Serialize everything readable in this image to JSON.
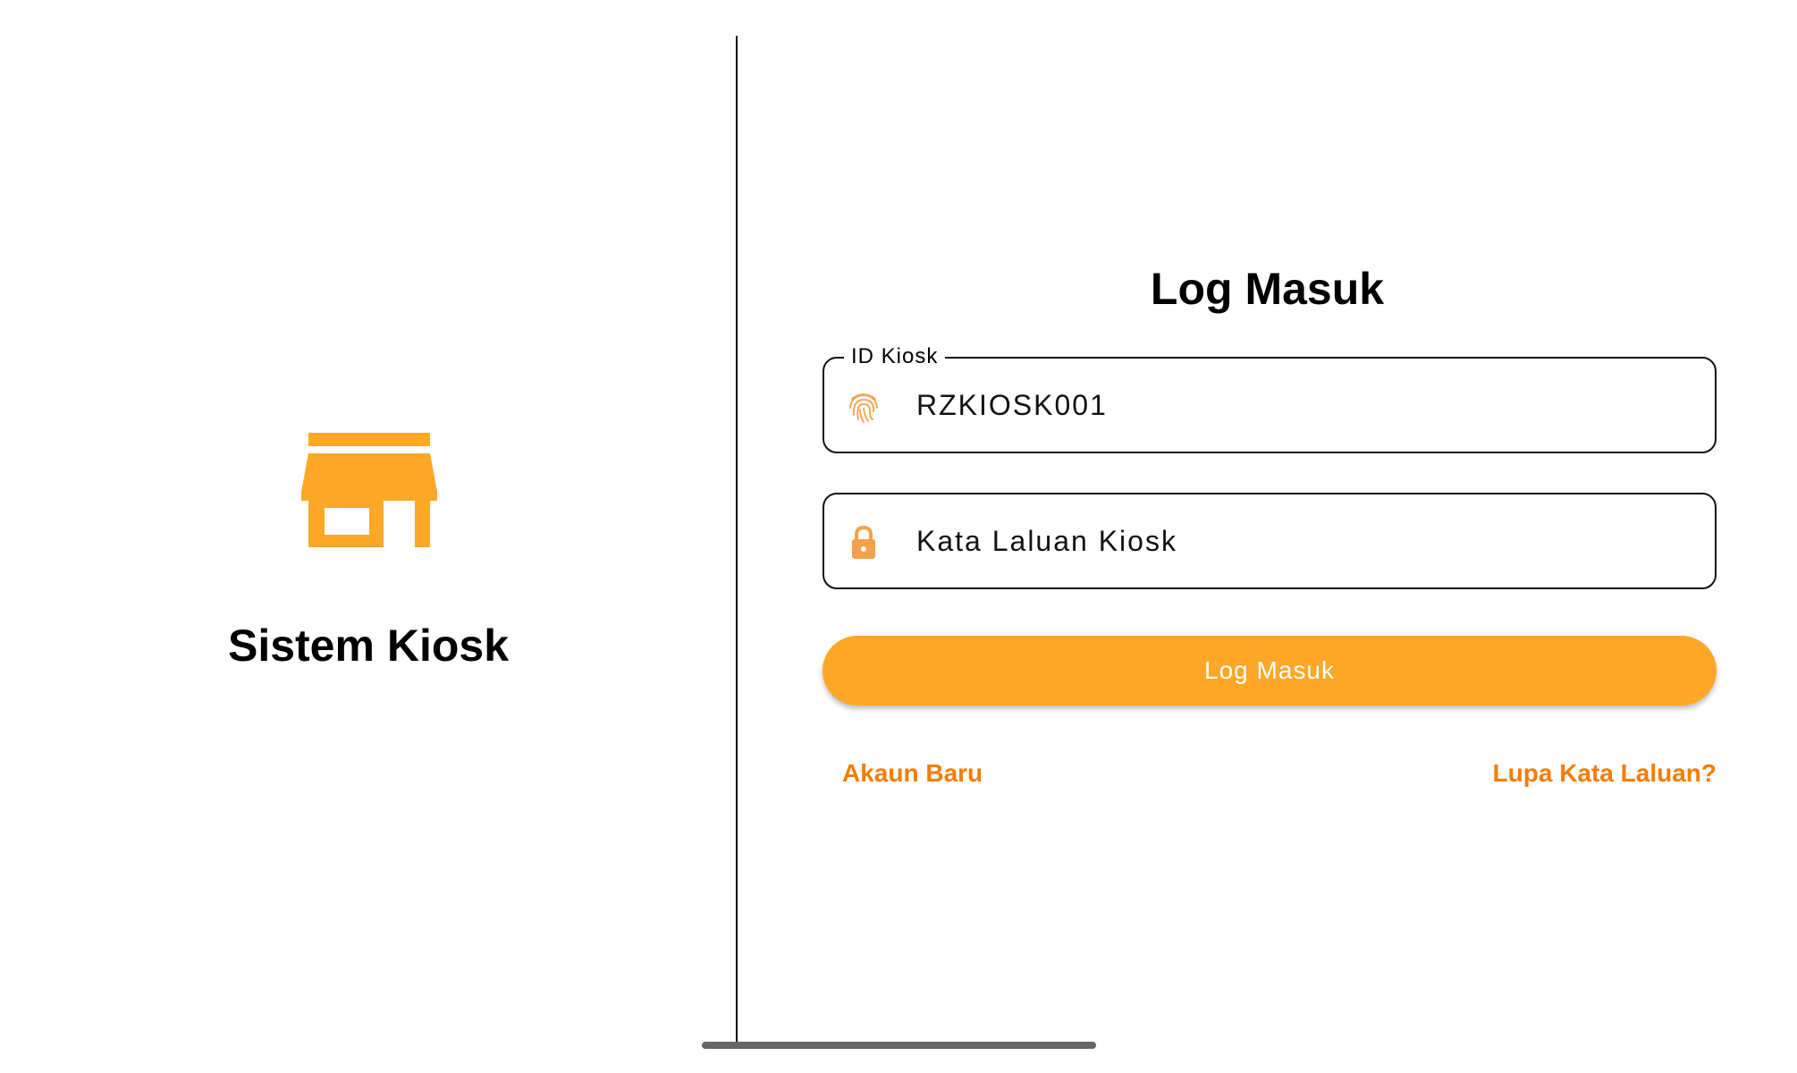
{
  "app": {
    "name": "Sistem Kiosk",
    "accent_color": "#FFA726",
    "link_color": "#F57C00",
    "logo_icon": "store-icon"
  },
  "login": {
    "title": "Log Masuk",
    "kiosk_id": {
      "label": "ID Kiosk",
      "value": "RZKIOSK001",
      "icon": "fingerprint-icon"
    },
    "password": {
      "placeholder": "Kata Laluan Kiosk",
      "icon": "lock-icon"
    },
    "submit_label": "Log Masuk",
    "new_account_label": "Akaun Baru",
    "forgot_password_label": "Lupa Kata Laluan?"
  }
}
